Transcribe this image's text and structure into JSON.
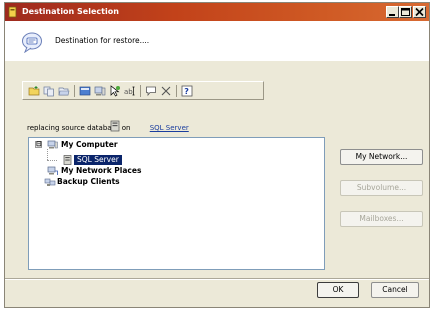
{
  "window": {
    "title": "Destination Selection"
  },
  "header": {
    "text": "Destination for restore...."
  },
  "toolbar": {
    "icons": [
      "new-folder-icon",
      "copy-icon",
      "open-folder-icon",
      "properties-icon",
      "computer-icon",
      "pointer-icon",
      "rename-icon",
      "comment-icon",
      "delete-icon",
      "help-icon"
    ]
  },
  "source": {
    "prefix": "replacing source database on",
    "server": "SQL Server"
  },
  "tree": {
    "items": [
      {
        "label": "My Computer",
        "expander": "⊟"
      },
      {
        "label": "SQL Server"
      },
      {
        "label": "My Network Places"
      },
      {
        "label": "Backup Clients"
      }
    ]
  },
  "buttons": {
    "my_network": "My Network...",
    "subvolume": "Subvolume...",
    "mailboxes": "Mailboxes...",
    "ok": "OK",
    "cancel": "Cancel"
  },
  "colors": {
    "titlebar": "#c2421a",
    "selection": "#0a246a",
    "face": "#ece9d8",
    "link": "#1a3d9e"
  }
}
